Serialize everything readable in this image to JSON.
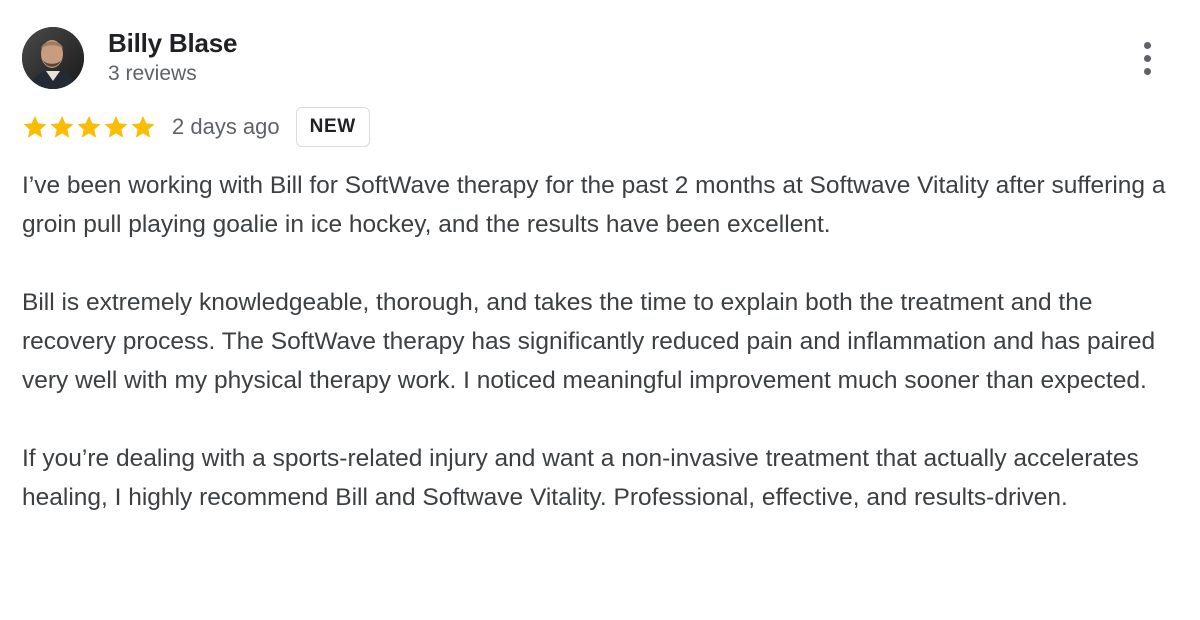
{
  "reviewer": {
    "name": "Billy Blase",
    "review_count": "3 reviews"
  },
  "rating": {
    "stars": 5,
    "max_stars": 5,
    "color": "#fbbc04"
  },
  "date": "2 days ago",
  "badge": "NEW",
  "icons": {
    "more": "more-vertical-icon",
    "star": "star-icon"
  },
  "review": {
    "paragraphs": [
      "I’ve been working with Bill for SoftWave therapy for the past 2 months at Softwave Vitality after suffering a groin pull playing goalie in ice hockey, and the results have been excellent.",
      "Bill is extremely knowledgeable, thorough, and takes the time to explain both the treatment and the recovery process. The SoftWave therapy has significantly reduced pain and inflammation and has paired very well with my physical therapy work. I noticed meaningful improvement much sooner than expected.",
      "If you’re dealing with a sports-related injury and want a non-invasive treatment that actually accelerates healing, I highly recommend Bill and Softwave Vitality. Professional, effective, and results-driven."
    ]
  }
}
